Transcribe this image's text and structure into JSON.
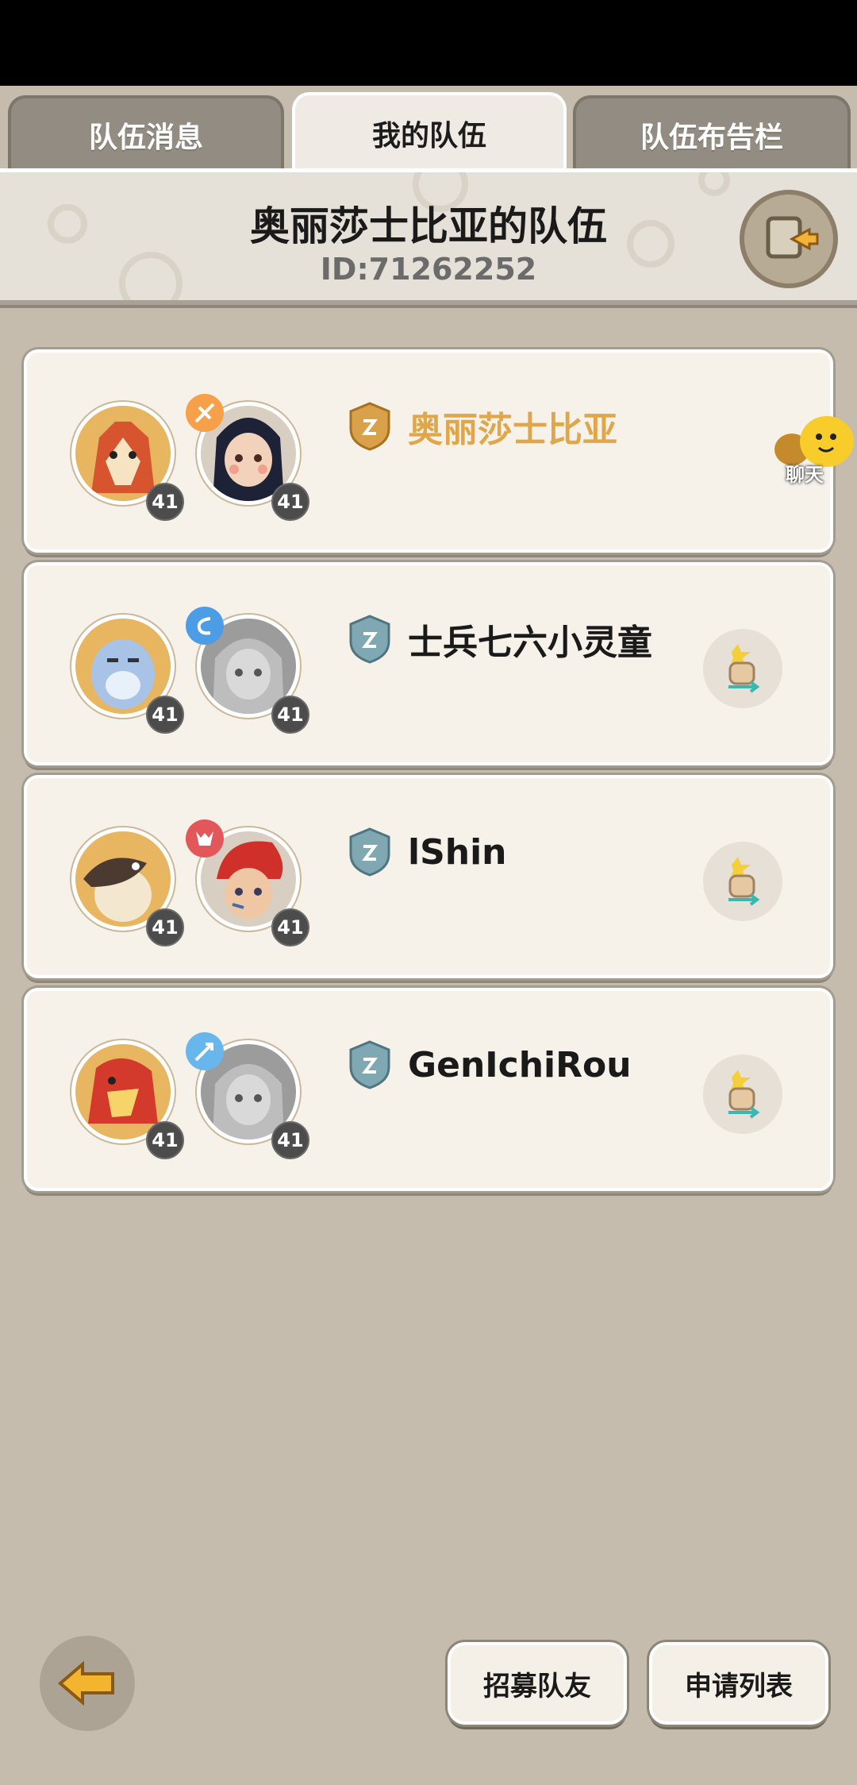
{
  "tabs": [
    {
      "label": "队伍消息",
      "active": false
    },
    {
      "label": "我的队伍",
      "active": true
    },
    {
      "label": "队伍布告栏",
      "active": false
    }
  ],
  "team": {
    "title": "奥丽莎士比亚的队伍",
    "id_text": "ID:71262252"
  },
  "members": [
    {
      "name": "奥丽莎士比亚",
      "leader": true,
      "pet_level": "41",
      "char_level": "41",
      "badge_color": "#d9a24a",
      "element": "fire"
    },
    {
      "name": "士兵七六小灵童",
      "leader": false,
      "pet_level": "41",
      "char_level": "41",
      "badge_color": "#6f9aa6",
      "element": "water"
    },
    {
      "name": "lShin",
      "leader": false,
      "pet_level": "41",
      "char_level": "41",
      "badge_color": "#6f9aa6",
      "element": "demon"
    },
    {
      "name": "GenIchiRou",
      "leader": false,
      "pet_level": "41",
      "char_level": "41",
      "badge_color": "#6f9aa6",
      "element": "ice"
    }
  ],
  "chat": {
    "label": "聊天"
  },
  "buttons": {
    "recruit": "招募队友",
    "apply_list": "申请列表"
  },
  "colors": {
    "background": "#c6bcae",
    "card": "#f6f1e9",
    "leader_name": "#e0a74a",
    "level_badge": "#4c4c4c"
  }
}
